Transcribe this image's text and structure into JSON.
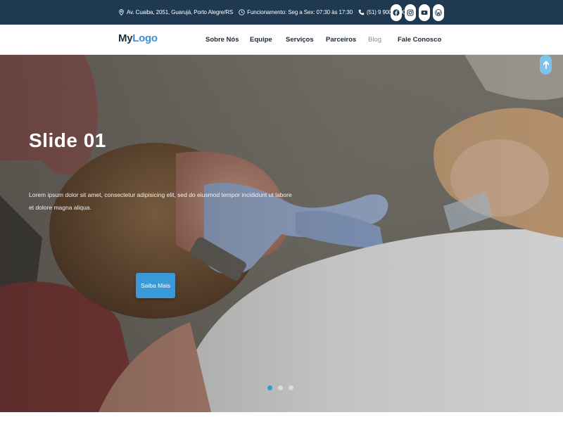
{
  "topbar": {
    "address": "Av. Cuaiba, 2051, Guarujá, Porto Alegre/RS",
    "hours": "Funcionamento: Seg a Sex: 07:30 às 17:30",
    "phone": "(51) 9 9000-0000",
    "social": [
      "facebook-icon",
      "instagram-icon",
      "youtube-icon",
      "wordpress-icon"
    ]
  },
  "nav": {
    "logo_my": "My",
    "logo_logo": "Logo",
    "items": [
      "Sobre Nós",
      "Equipe",
      "Serviços",
      "Parceiros",
      "Blog",
      "Fale Conosco"
    ]
  },
  "hero": {
    "title": "Slide 01",
    "text": "Lorem ipsum dolor sit amet, consectetur adipisicing elit, sed do eiusmod tempor incididunt ut labore et dolore magna aliqua.",
    "button": "Saiba Mais",
    "slides_count": 3,
    "active_slide": 1
  },
  "colors": {
    "topbar_bg": "#1f3a50",
    "accent": "#3a9ad9",
    "logo_accent": "#3b8fd6"
  }
}
